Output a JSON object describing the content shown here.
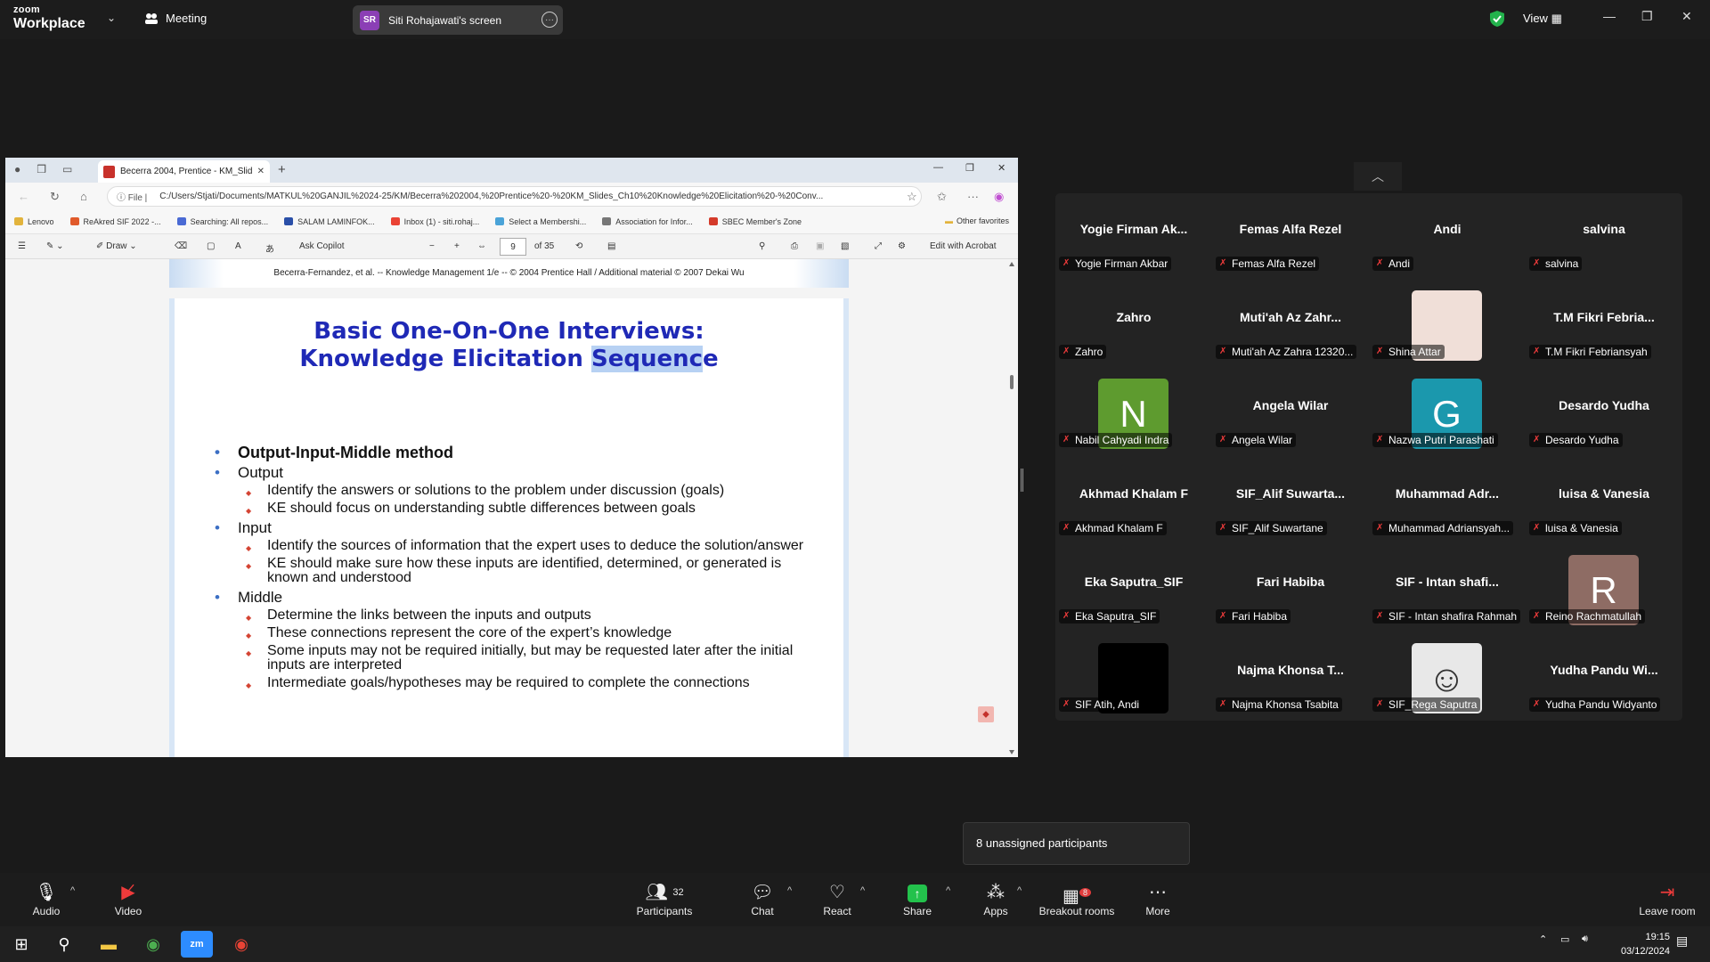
{
  "zoom": {
    "brand_small": "zoom",
    "brand_large": "Workplace",
    "meeting_label": "Meeting",
    "screen_share_initials": "SR",
    "screen_share_label": "Siti Rohajawati's screen",
    "view_label": "View"
  },
  "browser": {
    "tab_title": "Becerra 2004, Prentice - KM_Slid",
    "address_scheme": "File",
    "address": "C:/Users/Stjati/Documents/MATKUL%20GANJIL%2024-25/KM/Becerra%202004,%20Prentice%20-%20KM_Slides_Ch10%20Knowledge%20Elicitation%20-%20Conv...",
    "bookmarks": [
      {
        "label": "Lenovo",
        "color": "#e2b33c"
      },
      {
        "label": "ReAkred SIF 2022 -...",
        "color": "#e05a2b"
      },
      {
        "label": "Searching: All repos...",
        "color": "#4a6ad4"
      },
      {
        "label": "SALAM LAMINFOK...",
        "color": "#2a4fa8"
      },
      {
        "label": "Inbox (1) - siti.rohaj...",
        "color": "#ea4335"
      },
      {
        "label": "Select a Membershi...",
        "color": "#4aa3d8"
      },
      {
        "label": "Association for Infor...",
        "color": "#777777"
      },
      {
        "label": "SBEC Member's Zone",
        "color": "#d43a2a"
      }
    ],
    "other_favorites": "Other favorites"
  },
  "pdf_toolbar": {
    "draw": "Draw",
    "ask_copilot": "Ask Copilot",
    "page_current": "9",
    "page_total": "of 35",
    "edit_acrobat": "Edit with Acrobat"
  },
  "slide": {
    "header_strip": "Becerra-Fernandez, et al. -- Knowledge Management 1/e  --  © 2004 Prentice Hall / Additional material © 2007 Dekai Wu",
    "title_line1": "Basic One-On-One Interviews:",
    "title_line2_pre": "Knowledge Elicitation ",
    "title_line2_hl": "Sequenc",
    "title_line2_post": "e",
    "method": "Output-Input-Middle method",
    "output": "Output",
    "output_items": [
      "Identify the answers or solutions to the problem under discussion (goals)",
      "KE should focus on understanding subtle differences between goals"
    ],
    "input": "Input",
    "input_items": [
      "Identify the sources of information that the expert uses to deduce the solution/answer",
      "KE should make sure how these inputs are identified, determined, or generated is known and understood"
    ],
    "middle": "Middle",
    "middle_items": [
      "Determine the links between the inputs and outputs",
      "These connections represent the core of the expert’s knowledge",
      "Some inputs may not be required initially, but may be requested later after the initial inputs are interpreted",
      "Intermediate goals/hypotheses may be required to complete the connections"
    ]
  },
  "gallery": [
    {
      "name": "Yogie Firman Ak...",
      "label": "Yogie Firman Akbar"
    },
    {
      "name": "Femas Alfa Rezel",
      "label": "Femas Alfa Rezel"
    },
    {
      "name": "Andi",
      "label": "Andi"
    },
    {
      "name": "salvina",
      "label": "salvina"
    },
    {
      "name": "Zahro",
      "label": "Zahro"
    },
    {
      "name": "Muti'ah Az Zahr...",
      "label": "Muti'ah Az Zahra 12320..."
    },
    {
      "name": "",
      "label": "Shina Attar",
      "avatar": "",
      "avatar_color": "#f0dfd8"
    },
    {
      "name": "T.M Fikri Febria...",
      "label": "T.M Fikri Febriansyah"
    },
    {
      "name": "",
      "label": "Nabil Cahyadi Indra",
      "avatar": "N",
      "avatar_color": "#5e9b2f"
    },
    {
      "name": "Angela Wilar",
      "label": "Angela Wilar"
    },
    {
      "name": "",
      "label": "Nazwa Putri Parashati",
      "avatar": "G",
      "avatar_color": "#1b98ad"
    },
    {
      "name": "Desardo Yudha",
      "label": "Desardo Yudha"
    },
    {
      "name": "Akhmad Khalam F",
      "label": "Akhmad Khalam F"
    },
    {
      "name": "SIF_Alif  Suwarta...",
      "label": "SIF_Alif Suwartane"
    },
    {
      "name": "Muhammad  Adr...",
      "label": "Muhammad Adriansyah..."
    },
    {
      "name": "luisa & Vanesia",
      "label": "luisa & Vanesia"
    },
    {
      "name": "Eka Saputra_SIF",
      "label": "Eka Saputra_SIF"
    },
    {
      "name": "Fari Habiba",
      "label": "Fari Habiba"
    },
    {
      "name": "SIF - Intan shafi...",
      "label": "SIF - Intan shafira Rahmah"
    },
    {
      "name": "",
      "label": "Reino Rachmatullah",
      "avatar": "R",
      "avatar_color": "#8e6c64"
    },
    {
      "name": "",
      "label": "SIF Atih, Andi",
      "avatar": "",
      "avatar_color": "#000000"
    },
    {
      "name": "Najma Khonsa T...",
      "label": "Najma Khonsa Tsabita"
    },
    {
      "name": "",
      "label": "SIF_Rega Saputra",
      "avatar": "☺",
      "avatar_color": "#e8e8e8"
    },
    {
      "name": "Yudha Pandu Wi...",
      "label": "Yudha Pandu Widyanto"
    }
  ],
  "unassigned": "8 unassigned participants",
  "controls": {
    "audio": "Audio",
    "video": "Video",
    "participants": "Participants",
    "participants_count": "32",
    "chat": "Chat",
    "react": "React",
    "share": "Share",
    "apps": "Apps",
    "breakout": "Breakout rooms",
    "breakout_badge": "8",
    "more": "More",
    "leave": "Leave room"
  },
  "taskbar": {
    "time": "19:15",
    "date": "03/12/2024"
  }
}
